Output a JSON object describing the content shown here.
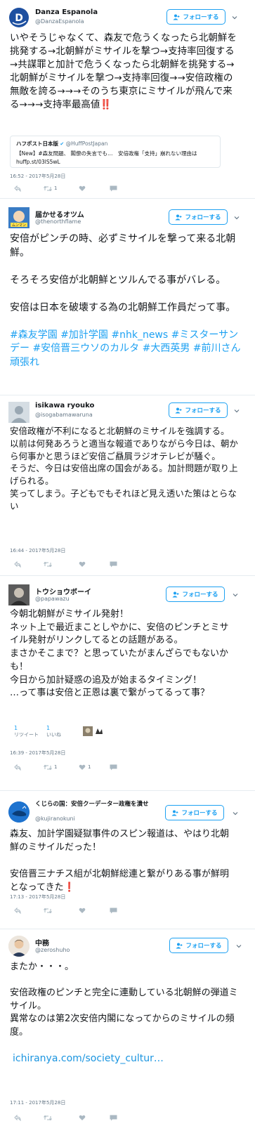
{
  "follow_label": "フォローする",
  "tweets": [
    {
      "name": "Danza Espanola",
      "handle": "@DanzaEspanola",
      "text": "いやそうじゃなくて、森友で危うくなったら北朝鮮を挑発する→北朝鮮がミサイルを撃つ→支持率回復する→共謀罪と加計で危うくなったら北朝鮮を挑発する→北朝鮮がミサイルを撃つ→支持率回復→→安倍政権の無敵を誇る→→→そのうち東京にミサイルが飛んで来る→→→支持率最高値‼️",
      "quote": {
        "source": "ハフポスト日本版",
        "handle": "@HuffPostJapan",
        "text": "【New】#森友問題、 閣僚の失言でも…　安倍政権「支持」崩れない理由は",
        "url": "huffp.st/03lS5wL"
      },
      "time": "16:52 - 2017年5月28日",
      "retweets": "1"
    },
    {
      "name": "届かせるオツム",
      "handle": "@thenorthflame",
      "text": "安倍がピンチの時、必ずミサイルを撃って来る北朝鮮。\n\nそろそろ安倍が北朝鮮とツルんでる事がバレる。\n\n安倍は日本を破壊する為の北朝鮮工作員だって事。\n\n",
      "hashtags": "#森友学園 #加計学園 #nhk_news #ミスターサンデー #安倍晋三ウソのカルタ #大西英男 #前川さん頑張れ"
    },
    {
      "name": "isikawa ryouko",
      "handle": "@isogabamawaruna",
      "text": "安倍政権が不利になると北朝鮮のミサイルを強調する。\n以前は何発あろうと適当な報道でありながら今日は、朝から何事かと思うほど安倍ご贔屓ラジオテレビが騒ぐ。\nそうだ、今日は安倍出席の国会がある。加計問題が取り上げられる。\n笑ってしまう。子どもでもそれほど見え透いた策はとらない",
      "time": "16:44 - 2017年5月28日"
    },
    {
      "name": "トウショウボーイ",
      "handle": "@papawazu",
      "text": "今朝北朝鮮がミサイル発射！\nネット上で最近まことしやかに、安倍のピンチとミサイル発射がリンクしてるとの話題がある。\nまさかそこまで？と思っていたがまんざらでもないかも！\n今日から加計疑惑の追及が始まるタイミング！\n…って事は安倍と正恩は裏で繋がってるって事？",
      "retweet_count": "1",
      "retweet_label": "リツイート",
      "like_count": "1",
      "like_label": "いいね",
      "time": "16:39 - 2017年5月28日",
      "retweets": "1",
      "likes": "1"
    },
    {
      "name": "くじらの国：安倍クーデーター政権を潰せ",
      "handle": "@kujiranokuni",
      "text": "森友、加計学園疑獄事件のスピン報道は、やはり北朝鮮のミサイルだった！\n\n安倍晋三ナチス組が北朝鮮総連と繋がりある事が鮮明となってきた❗️",
      "time": "17:13 - 2017年5月28日"
    },
    {
      "name": "中務",
      "handle": "@zeroshuho",
      "text": "またか・・・。\n\n安倍政権のピンチと完全に連動している北朝鮮の弾道ミサイル。\n異常なのは第2次安倍内閣になってからのミサイルの頻度。\n\n",
      "link": "ichiranya.com/society_cultur…",
      "time": "17:11 - 2017年5月28日"
    }
  ]
}
